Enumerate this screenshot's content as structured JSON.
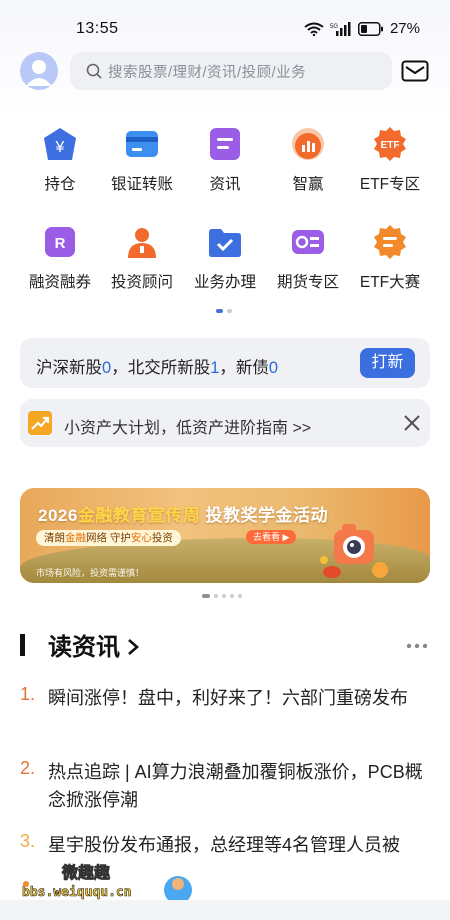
{
  "status_bar": {
    "time": "13:55",
    "battery": "27%",
    "network": "5G"
  },
  "header": {
    "search_placeholder": "搜索股票/理财/资讯/投顾/业务"
  },
  "grid": [
    {
      "label": "持仓",
      "icon": "holdings-icon",
      "color": "#3e6fe0"
    },
    {
      "label": "银证转账",
      "icon": "bank-transfer-icon",
      "color": "#3e8ef0"
    },
    {
      "label": "资讯",
      "icon": "news-icon",
      "color": "#9b5ce6"
    },
    {
      "label": "智赢",
      "icon": "smart-win-icon",
      "color": "#f26a2c"
    },
    {
      "label": "ETF专区",
      "icon": "etf-icon",
      "color": "#f26a2c"
    },
    {
      "label": "融资融券",
      "icon": "margin-trading-icon",
      "color": "#9b5ce6"
    },
    {
      "label": "投资顾问",
      "icon": "advisor-icon",
      "color": "#f26a2c"
    },
    {
      "label": "业务办理",
      "icon": "business-icon",
      "color": "#3e6fe0"
    },
    {
      "label": "期货专区",
      "icon": "futures-icon",
      "color": "#9b5ce6"
    },
    {
      "label": "ETF大赛",
      "icon": "etf-contest-icon",
      "color": "#f28a2c"
    }
  ],
  "newstock": {
    "part1": "沪深新股",
    "num1": "0",
    "part2": "，北交所新股",
    "num2": "1",
    "part3": "，新债",
    "num3": "0",
    "button": "打新"
  },
  "tip": {
    "text": "小资产大计划，低资产进阶指南 >>"
  },
  "banner": {
    "title_a": "2026",
    "title_hl": "金融教育宣传周",
    "title_b": " 投教奖学金活动",
    "sub_a": "清朗",
    "sub_hl1": "金融",
    "sub_b": "网络 守护",
    "sub_hl2": "安心",
    "sub_c": "投资",
    "button": "去看看 ▶",
    "note": "市场有风险，投资需谨慎！"
  },
  "news": {
    "title": "读资讯",
    "items": [
      {
        "index": "1.",
        "text": "瞬间涨停！盘中，利好来了！六部门重磅发布"
      },
      {
        "index": "2.",
        "text": "热点追踪 | AI算力浪潮叠加覆铜板涨价，PCB概念掀涨停潮"
      },
      {
        "index": "3.",
        "text": "星宇股份发布通报，总经理等4名管理人员被"
      }
    ]
  },
  "watermark": {
    "line1": "微趣趣",
    "line2": "bbs.weiququ.cn"
  },
  "colors": {
    "accent": "#3b6fe0",
    "number": "#2c6bd7",
    "index": "#e2733a"
  }
}
